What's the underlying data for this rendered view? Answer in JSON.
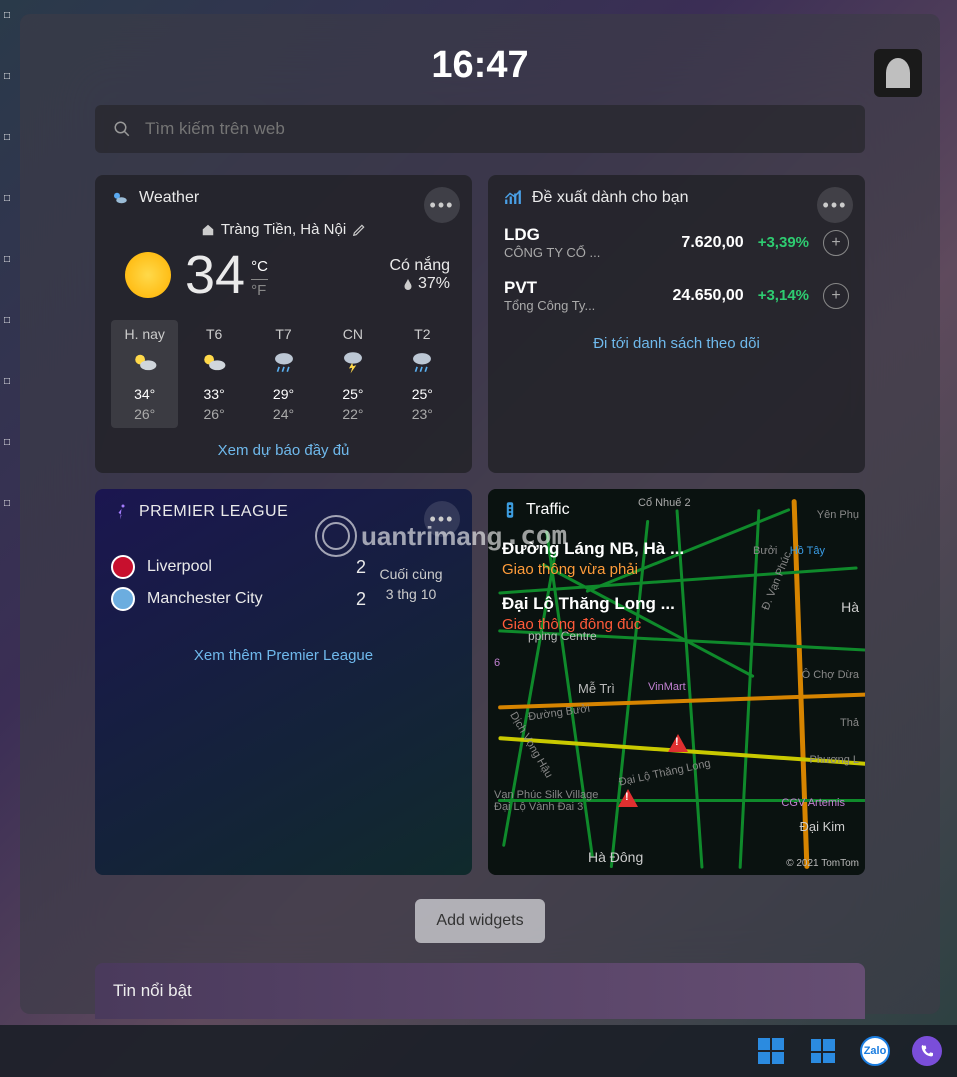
{
  "time": "16:47",
  "search": {
    "placeholder": "Tìm kiếm trên web"
  },
  "weather": {
    "title": "Weather",
    "location": "Tràng Tiền, Hà Nội",
    "temp": "34",
    "unit_c": "°C",
    "unit_f": "°F",
    "condition": "Có nắng",
    "humidity": "37%",
    "days": [
      {
        "name": "H. nay",
        "hi": "34°",
        "lo": "26°",
        "icon": "sun-cloud"
      },
      {
        "name": "T6",
        "hi": "33°",
        "lo": "26°",
        "icon": "sun-cloud"
      },
      {
        "name": "T7",
        "hi": "29°",
        "lo": "24°",
        "icon": "rain"
      },
      {
        "name": "CN",
        "hi": "25°",
        "lo": "22°",
        "icon": "thunder"
      },
      {
        "name": "T2",
        "hi": "25°",
        "lo": "23°",
        "icon": "rain"
      }
    ],
    "link": "Xem dự báo đầy đủ"
  },
  "stocks": {
    "title": "Đề xuất dành cho bạn",
    "rows": [
      {
        "sym": "LDG",
        "name": "CÔNG TY CỔ ...",
        "price": "7.620,00",
        "change": "+3,39%"
      },
      {
        "sym": "PVT",
        "name": "Tổng Công Ty...",
        "price": "24.650,00",
        "change": "+3,14%"
      }
    ],
    "link": "Đi tới danh sách theo dõi"
  },
  "sports": {
    "title": "PREMIER LEAGUE",
    "teams": [
      {
        "name": "Liverpool",
        "score": "2",
        "color": "#c8102e"
      },
      {
        "name": "Manchester City",
        "score": "2",
        "color": "#6caddf"
      }
    ],
    "status": "Cuối cùng",
    "date": "3 thg 10",
    "link": "Xem thêm Premier League"
  },
  "traffic": {
    "title": "Traffic",
    "routes": [
      {
        "name": "Đường Láng NB, Hà ...",
        "status": "Giao thông vừa phải",
        "class": "orange"
      },
      {
        "name": "Đại Lộ Thăng Long ...",
        "status": "Giao thông đông đúc",
        "class": "red"
      }
    ],
    "copyright": "© 2021 TomTom",
    "places": [
      "Cổ Nhuế 2",
      "Yên Phụ",
      "Hồ Tây",
      "Bưởi",
      "Hà",
      "Ô Chợ Dừa",
      "Thả",
      "Phương L",
      "CGV Artemis",
      "Đại Kim",
      "Hà Đông",
      "Mễ Trì",
      "VinMart",
      "Vạn Phúc Silk Village",
      "Đại Lộ Vành Đai 3",
      "Đại Lộ Thăng Long",
      "Đường Bưởi",
      "Đ. Vạn Phúc",
      "Dịch Vọng Hậu",
      "pping Centre",
      "6"
    ]
  },
  "add_widgets": "Add widgets",
  "news": {
    "title": "Tin nổi bật"
  },
  "taskbar": {
    "zalo": "Zalo"
  },
  "watermark": "uantrimang"
}
